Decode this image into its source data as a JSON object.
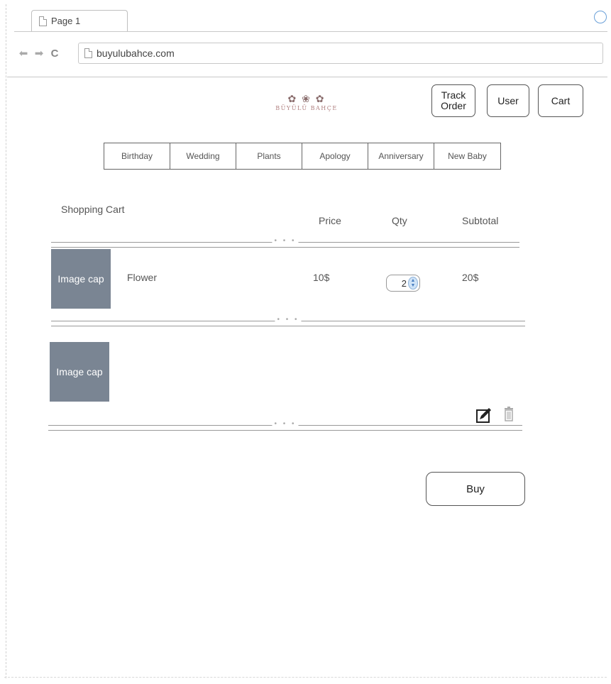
{
  "browser": {
    "tab_title": "Page 1",
    "url": "buyulubahce.com"
  },
  "header": {
    "logo_text": "BÜYÜLÜ BAHÇE",
    "track_order_line1": "Track",
    "track_order_line2": "Order",
    "user_label": "User",
    "cart_label": "Cart"
  },
  "categories": [
    "Birthday",
    "Wedding",
    "Plants",
    "Apology",
    "Anniversary",
    "New Baby"
  ],
  "cart": {
    "title": "Shopping Cart",
    "columns": {
      "price": "Price",
      "qty": "Qty",
      "subtotal": "Subtotal"
    },
    "items": [
      {
        "image_label": "Image cap",
        "name": "Flower",
        "price": "10$",
        "qty": "2",
        "subtotal": "20$"
      },
      {
        "image_label": "Image cap",
        "name": "",
        "price": "",
        "qty": "",
        "subtotal": ""
      }
    ],
    "separator_dots": "• • •",
    "buy_label": "Buy"
  },
  "icons": {
    "edit": "edit-icon",
    "delete": "trash-icon",
    "back": "back-arrow-icon",
    "forward": "forward-arrow-icon",
    "reload": "reload-icon"
  }
}
